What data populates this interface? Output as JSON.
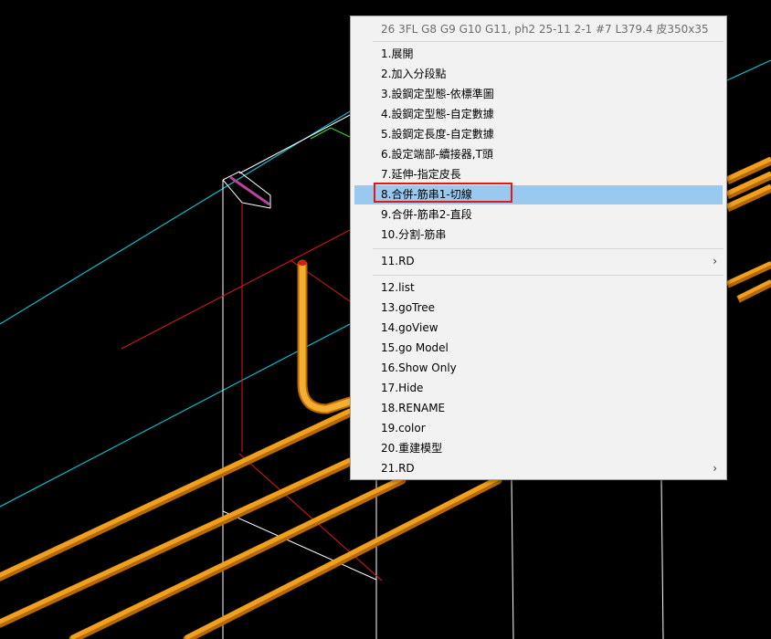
{
  "viewport": {
    "name": "3d-model-view",
    "colors": {
      "background": "#000000",
      "rebar": "#f0a020",
      "rebar_highlight": "#ffd070",
      "cyan_line": "#00d8e8",
      "red_line": "#e01818",
      "white_line": "#ffffff",
      "green_line": "#40e040",
      "magenta_line": "#c040a0"
    }
  },
  "context_menu": {
    "header": "26 3FL G8 G9 G10 G11, ph2 25-11 2-1 #7 L379.4 皮350x35",
    "groups": [
      [
        {
          "label": "1.展開"
        },
        {
          "label": "2.加入分段點"
        },
        {
          "label": "3.設鋼定型態-依標準圖"
        },
        {
          "label": "4.設鋼定型態-自定數據"
        },
        {
          "label": "5.設鋼定長度-自定數據"
        },
        {
          "label": "6.設定端部-續接器,T頭"
        },
        {
          "label": "7.延伸-指定皮長"
        },
        {
          "label": "8.合併-筋串1-切線",
          "highlighted": true
        },
        {
          "label": "9.合併-筋串2-直段"
        },
        {
          "label": "10.分割-筋串"
        }
      ],
      [
        {
          "label": "11.RD",
          "submenu": true
        }
      ],
      [
        {
          "label": "12.list"
        },
        {
          "label": "13.goTree"
        },
        {
          "label": "14.goView"
        },
        {
          "label": "15.go Model"
        },
        {
          "label": "16.Show Only"
        },
        {
          "label": "17.Hide"
        },
        {
          "label": "18.RENAME"
        },
        {
          "label": "19.color"
        },
        {
          "label": "20.重建模型"
        },
        {
          "label": "21.RD",
          "submenu": true
        }
      ]
    ],
    "submenu_glyph": "›",
    "colors": {
      "background": "#f2f2f2",
      "highlight": "#99c9ef",
      "annotation": "#e01818",
      "header_text": "#6d6d6d"
    }
  }
}
